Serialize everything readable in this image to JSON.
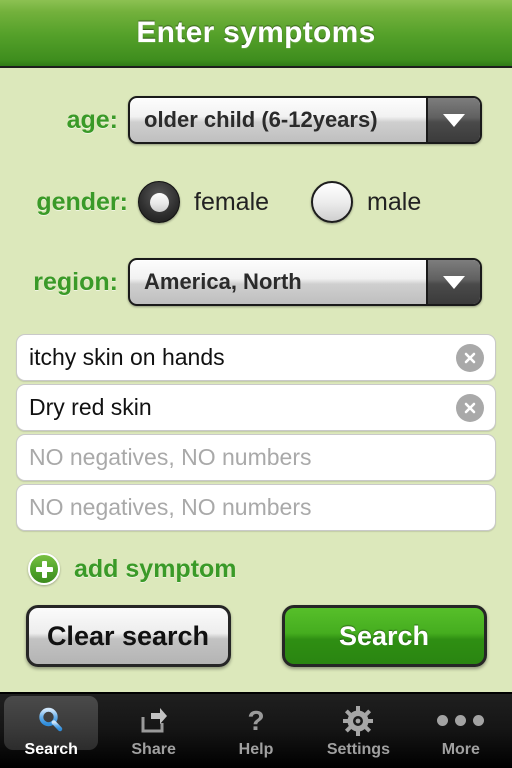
{
  "header": {
    "title": "Enter symptoms"
  },
  "form": {
    "age": {
      "label": "age:",
      "value": "older child (6-12years)",
      "arrow_icon": "chevron-down-icon"
    },
    "gender": {
      "label": "gender:",
      "options": [
        {
          "label": "female",
          "selected": true
        },
        {
          "label": "male",
          "selected": false
        }
      ]
    },
    "region": {
      "label": "region:",
      "value": "America, North",
      "arrow_icon": "chevron-down-icon"
    }
  },
  "symptoms": {
    "placeholder": "NO negatives, NO numbers",
    "clear_icon": "close-circle-icon",
    "rows": [
      {
        "value": "itchy skin on hands",
        "filled": true
      },
      {
        "value": "Dry red skin",
        "filled": true
      },
      {
        "value": "NO negatives, NO numbers",
        "filled": false
      },
      {
        "value": "NO negatives, NO numbers",
        "filled": false
      }
    ]
  },
  "add_symptom": {
    "label": "add symptom",
    "icon": "plus-circle-icon"
  },
  "actions": {
    "clear_label": "Clear search",
    "search_label": "Search"
  },
  "tabbar": {
    "items": [
      {
        "label": "Search",
        "icon": "search-icon",
        "active": true
      },
      {
        "label": "Share",
        "icon": "share-icon",
        "active": false
      },
      {
        "label": "Help",
        "icon": "question-mark-icon",
        "active": false
      },
      {
        "label": "Settings",
        "icon": "gear-icon",
        "active": false
      },
      {
        "label": "More",
        "icon": "ellipsis-icon",
        "active": false
      }
    ]
  },
  "colors": {
    "background": "#dce8bb",
    "header_green": "#55a12a",
    "label_green": "#3a9a28",
    "search_button_green": "#45ad1f",
    "active_tab_blue": "#6cb6f0"
  }
}
